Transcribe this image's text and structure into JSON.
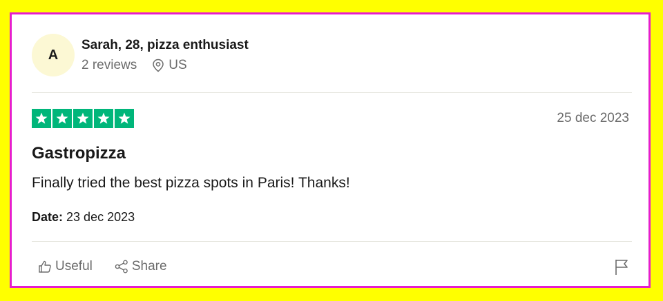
{
  "reviewer": {
    "avatar_initial": "A",
    "name": "Sarah, 28, pizza enthusiast",
    "reviews_count": "2 reviews",
    "location": "US"
  },
  "review": {
    "rating": 5,
    "max_rating": 5,
    "star_color": "#00B67A",
    "date": "25 dec 2023",
    "title": "Gastropizza",
    "body": "Finally tried the best pizza spots in Paris! Thanks!",
    "experience_date_label": "Date:",
    "experience_date_value": "23 dec 2023"
  },
  "actions": {
    "useful_label": "Useful",
    "share_label": "Share",
    "report_icon": "flag-icon"
  },
  "colors": {
    "background": "#FFFF00",
    "card_border": "#E61ECD",
    "avatar_bg": "#FCF8D4"
  }
}
